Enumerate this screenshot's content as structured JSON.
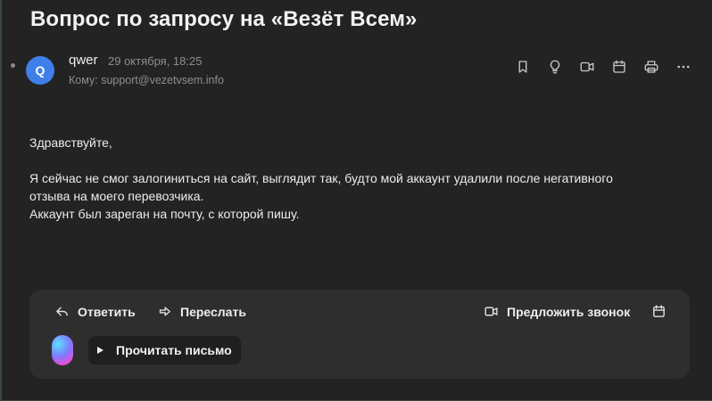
{
  "message": {
    "subject": "Вопрос по запросу на «Везёт Всем»",
    "sender": {
      "initial": "Q",
      "name": "qwer",
      "date": "29 октября, 18:25",
      "to_label": "Кому:",
      "to_address": "support@vezetvsem.info",
      "avatar_color": "#3f7fe8"
    },
    "body": {
      "greeting": "Здравствуйте,",
      "line1": "Я сейчас не смог залогиниться на сайт, выглядит так, будто мой аккаунт удалили после негативного",
      "line2": "отзыва на моего перевозчика.",
      "line3": "Аккаунт был зареган на почту, с которой пишу."
    }
  },
  "toolbar": {
    "icons": [
      "bookmark-icon",
      "lightbulb-icon",
      "video-call-icon",
      "calendar-icon",
      "print-icon",
      "more-icon"
    ]
  },
  "reply_box": {
    "reply_label": "Ответить",
    "forward_label": "Переслать",
    "propose_call_label": "Предложить звонок",
    "read_letter_label": "Прочитать письмо"
  }
}
